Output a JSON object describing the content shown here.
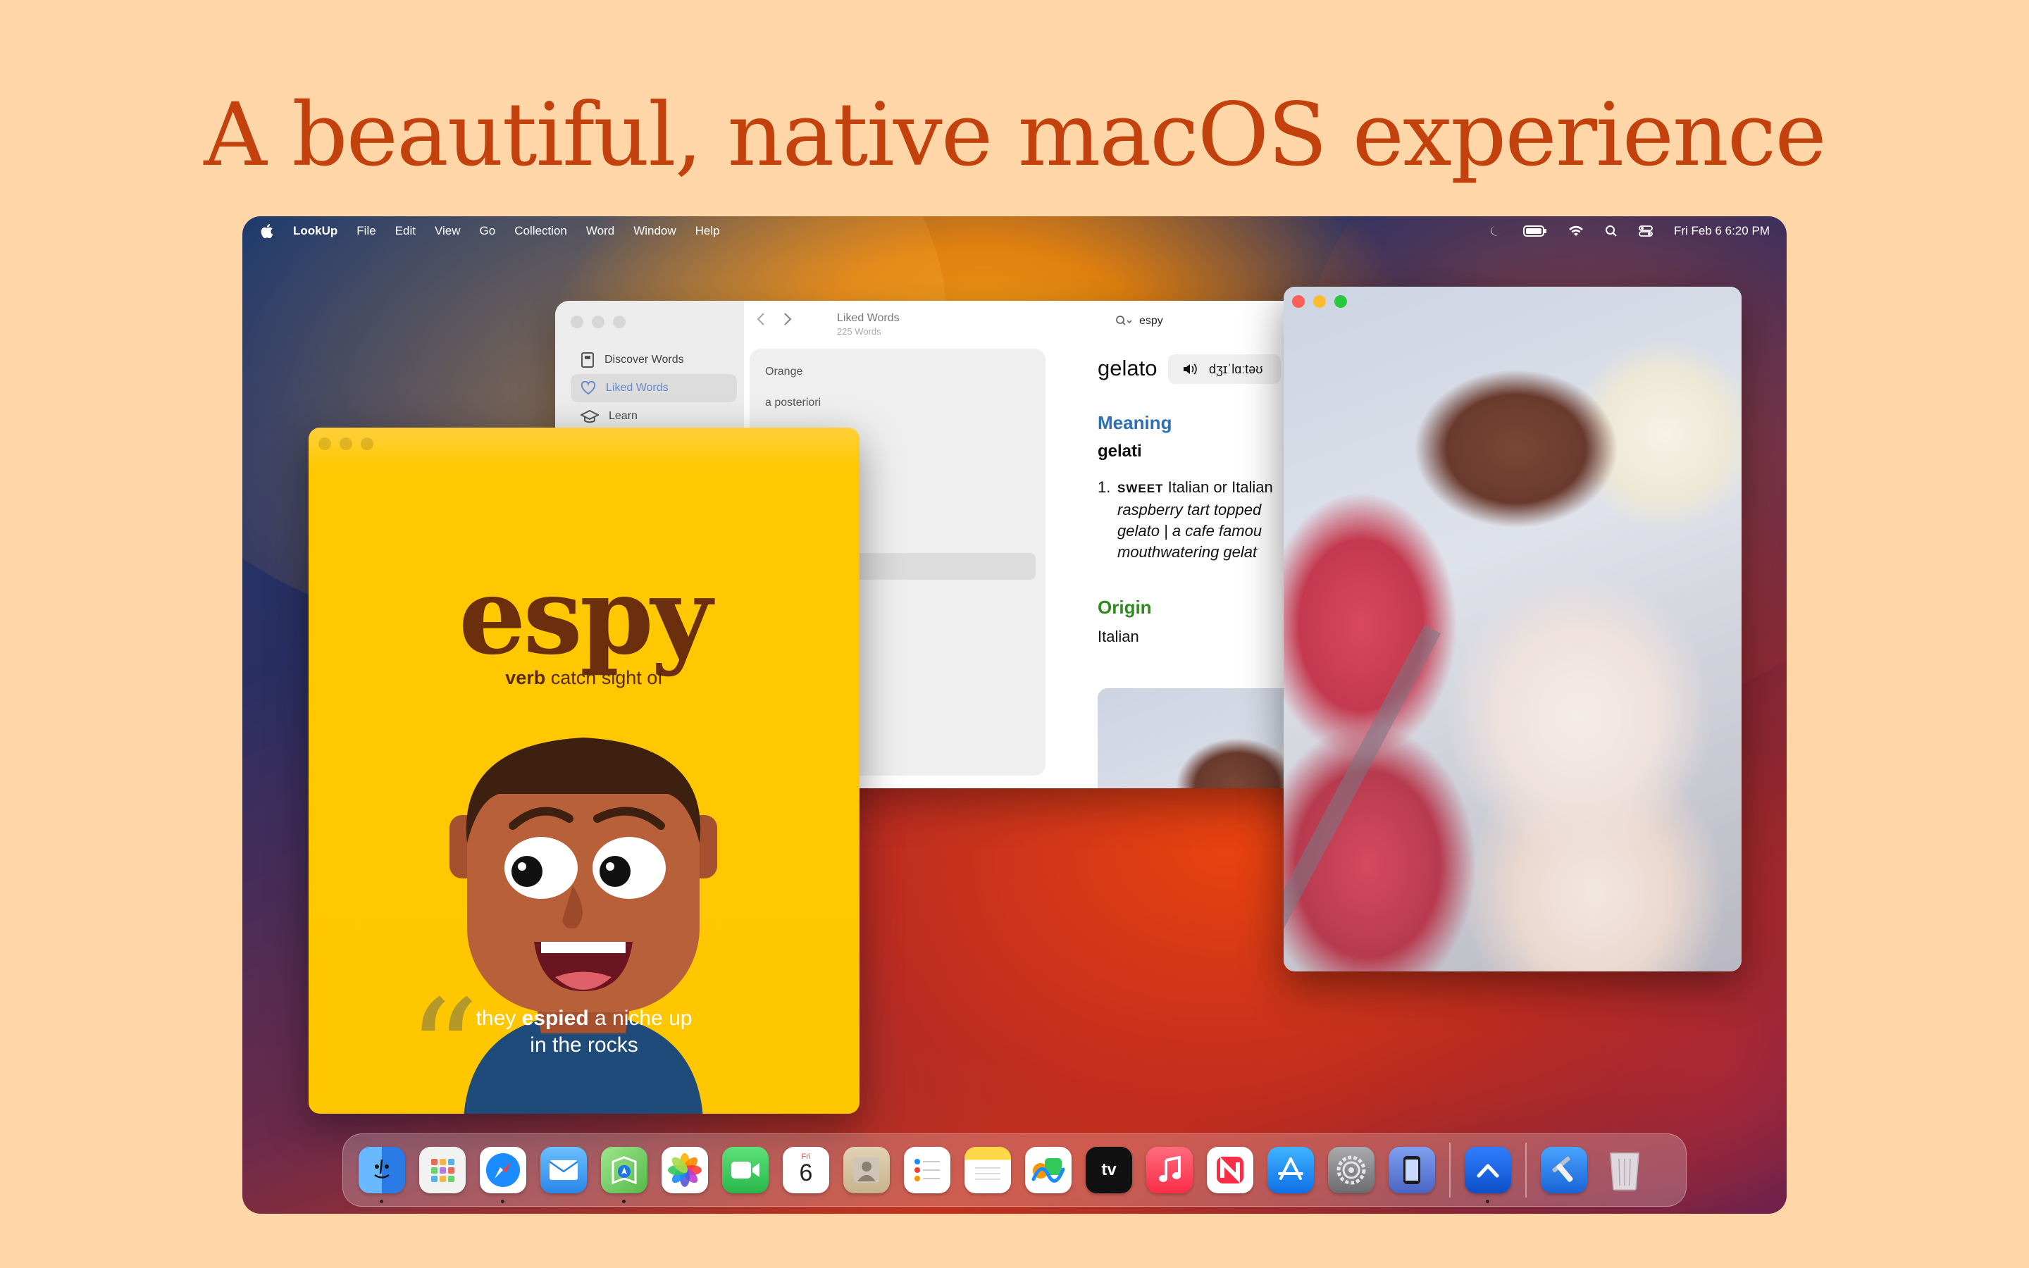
{
  "headline": "A beautiful, native macOS experience",
  "menubar": {
    "app_name": "LookUp",
    "menus": [
      "File",
      "Edit",
      "View",
      "Go",
      "Collection",
      "Word",
      "Window",
      "Help"
    ],
    "datetime": "Fri Feb 6  6:20 PM",
    "status_icons": [
      "moon-icon",
      "battery-icon",
      "wifi-icon",
      "search-icon",
      "control-center-icon"
    ]
  },
  "main_window": {
    "sidebar": {
      "items": [
        {
          "label": "Discover Words",
          "icon": "book-icon",
          "active": false
        },
        {
          "label": "Liked Words",
          "icon": "heart-icon",
          "active": true
        },
        {
          "label": "Learn",
          "icon": "graduation-cap-icon",
          "active": false
        }
      ]
    },
    "toolbar": {
      "title": "Liked Words",
      "subtitle": "225 Words",
      "search_value": "espy"
    },
    "list": {
      "items": [
        "Orange",
        "a posteriori"
      ]
    },
    "detail": {
      "word": "gelato",
      "pronunciation": "dʒɪˈlɑːtəʊ",
      "meaning_heading": "Meaning",
      "lemma": "gelati",
      "definition_number": "1.",
      "definition_tag": "SWEET",
      "definition_text": "Italian or Italian",
      "examples": [
        "raspberry tart topped",
        "gelato | a cafe famou",
        "mouthwatering gelat"
      ],
      "origin_heading": "Origin",
      "origin_value": "Italian"
    }
  },
  "flashcard": {
    "word": "espy",
    "part_of_speech": "verb",
    "definition": "catch sight of",
    "quote_before": "they ",
    "quote_bold": "espied",
    "quote_after": " a niche up",
    "quote_line2": "in the rocks"
  },
  "dock": {
    "apps": [
      {
        "name": "finder-icon",
        "bg": "#3d8ef5",
        "running": true
      },
      {
        "name": "launchpad-icon",
        "bg": "#f2f2f2",
        "running": false
      },
      {
        "name": "safari-icon",
        "bg": "#ffffff",
        "running": true
      },
      {
        "name": "mail-icon",
        "bg": "#4aa3f5",
        "running": false
      },
      {
        "name": "maps-icon",
        "bg": "#7bd36c",
        "running": true
      },
      {
        "name": "photos-icon",
        "bg": "#ffffff",
        "running": false
      },
      {
        "name": "facetime-icon",
        "bg": "#34c759",
        "running": false
      },
      {
        "name": "calendar-icon",
        "bg": "#ffffff",
        "running": false,
        "day": "Fri",
        "date": "6"
      },
      {
        "name": "contacts-icon",
        "bg": "#d9c8a8",
        "running": false
      },
      {
        "name": "reminders-icon",
        "bg": "#ffffff",
        "running": false
      },
      {
        "name": "notes-icon",
        "bg": "#ffffff",
        "running": false
      },
      {
        "name": "freeform-icon",
        "bg": "#ffffff",
        "running": false
      },
      {
        "name": "tv-icon",
        "bg": "#111111",
        "running": false,
        "label": "tv"
      },
      {
        "name": "music-icon",
        "bg": "#fa3c52",
        "running": false
      },
      {
        "name": "news-icon",
        "bg": "#ffffff",
        "running": false
      },
      {
        "name": "app-store-icon",
        "bg": "#1a8cff",
        "running": false
      },
      {
        "name": "system-settings-icon",
        "bg": "#8e8e93",
        "running": false
      },
      {
        "name": "simulator-icon",
        "bg": "#5a7fd6",
        "running": false
      },
      {
        "name": "lookup-icon",
        "bg": "#1a63d6",
        "running": true
      },
      {
        "name": "xcode-icon",
        "bg": "#1a73e8",
        "running": false
      },
      {
        "name": "trash-icon",
        "bg": "#d0d0d0",
        "running": false
      }
    ]
  }
}
